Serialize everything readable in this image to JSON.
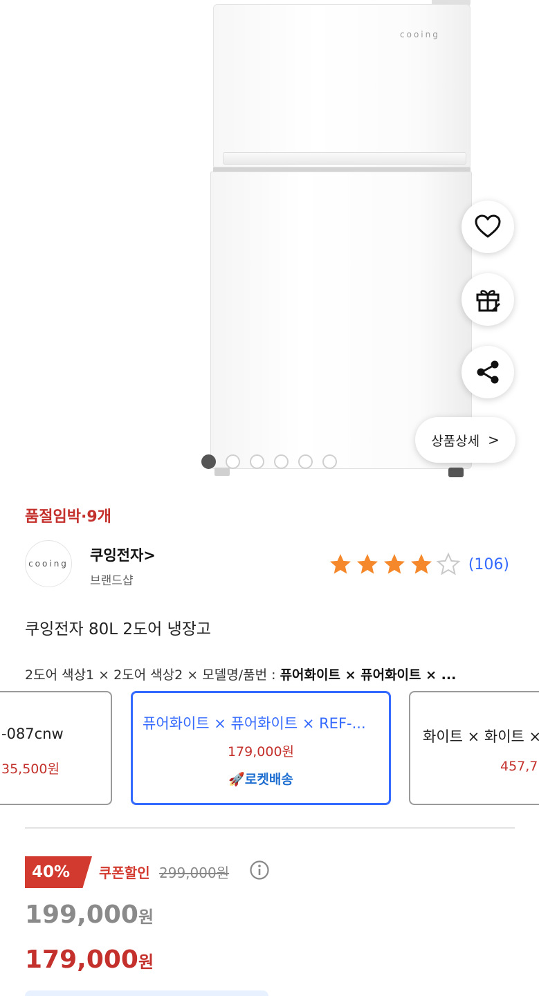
{
  "product_image": {
    "brand_mark": "cooing",
    "carousel": {
      "total": 6,
      "active_index": 0
    }
  },
  "actions": {
    "like_icon": "heart-icon",
    "gift_icon": "gift-icon",
    "share_icon": "share-icon",
    "detail_label": "상품상세",
    "detail_chevron": ">"
  },
  "stock_notice": "품절임박·9개",
  "brand": {
    "logo_text": "cooing",
    "name": "쿠잉전자>",
    "sub": "브랜드샵"
  },
  "rating": {
    "stars_filled": 4,
    "stars_total": 5,
    "count": "(106)",
    "star_color": "#f5882a"
  },
  "title": "쿠잉전자 80L 2도어 냉장고",
  "options_summary": {
    "prefix": "2도어 색상1 × 2도어 색상2 × 모델명/품번 : ",
    "selected": "퓨어화이트 × 퓨어화이트 × ..."
  },
  "option_cards": [
    {
      "line1": "-087cnw",
      "price": "35,500원"
    },
    {
      "line1": "퓨어화이트 × 퓨어화이트 × REF-...",
      "price": "179,000원",
      "badge": "로켓배송",
      "selected": true
    },
    {
      "line1": "화이트 × 화이트 ×",
      "price": "457,7"
    }
  ],
  "pricing": {
    "discount_percent": "40%",
    "coupon_label": "쿠폰할인",
    "original_price": "299,000원",
    "sale_price_number": "199,000",
    "final_price_number": "179,000",
    "currency": "원"
  },
  "colors": {
    "accent_red": "#c4302b",
    "accent_blue": "#346aff",
    "rocket_blue": "#1f6fd1"
  }
}
